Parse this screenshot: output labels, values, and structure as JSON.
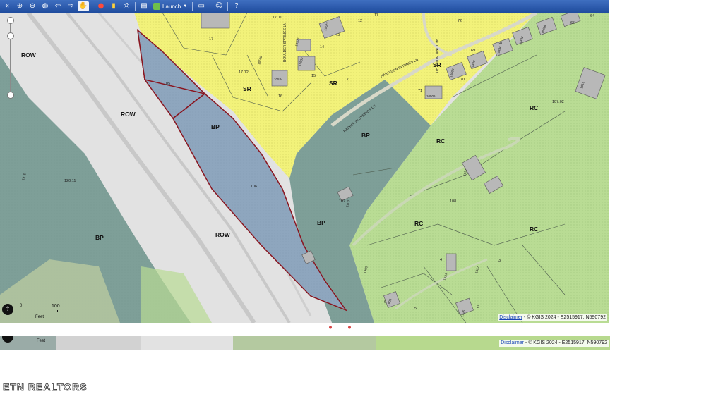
{
  "toolbar": {
    "launch_label": "Launch",
    "buttons": [
      "collapse-icon",
      "zoom-in-icon",
      "zoom-out-icon",
      "full-extent-icon",
      "back-icon",
      "forward-icon",
      "pan-hand-icon",
      "identify-icon",
      "layers-icon",
      "print-icon",
      "ruler-icon",
      "save-icon",
      "person-icon",
      "help-icon"
    ]
  },
  "map": {
    "zone_labels": {
      "row_1": "ROW",
      "row_2": "ROW",
      "row_3": "ROW",
      "sr_1": "SR",
      "sr_2": "SR",
      "sr_3": "SR",
      "bp_1": "BP",
      "bp_2": "BP",
      "bp_3": "BP",
      "bp_4": "BP",
      "rc_1": "RC",
      "rc_2": "RC",
      "rc_3": "RC",
      "rc_4": "RC"
    },
    "parcel_numbers": {
      "p105": "105",
      "p106": "106",
      "p107": "107",
      "p107_02": "107.02",
      "p108": "108",
      "p120_11": "120.11",
      "p17": "17",
      "p17_12": "17.12",
      "p17_11": "17.11",
      "p16": "16",
      "p15": "15",
      "p14": "14",
      "p13": "13",
      "p12": "12",
      "p11": "11",
      "p7": "7",
      "p72": "72",
      "p64": "64",
      "p65": "65",
      "p68": "68",
      "p69": "69",
      "p70": "70",
      "p71": "71",
      "p4": "4",
      "p3": "3",
      "p5": "5",
      "p2": "2",
      "p6": "6"
    },
    "street_labels": {
      "harrison_springs": "HARRISON SPRINGS LN",
      "autumn_bluff": "AUTUMN BLUFF RD",
      "boulder_springs": "BOULDER SPRINGS LN",
      "harrison_lower": "HARRISON SPRINGS LN"
    },
    "address_labels": {
      "a10534": "10534",
      "a10530": "10530",
      "a10526": "10526",
      "a10522": "10522",
      "a10535": "10535",
      "a10600": "10600",
      "a10440": "10440",
      "a10436": "10436",
      "a10432": "10432",
      "a10426": "10426",
      "a10506": "10506",
      "a1919": "1919",
      "a1915": "1915",
      "a1907": "1907",
      "a1824": "1824",
      "a1822": "1822",
      "a1825": "1825",
      "a1925": "1925",
      "a1932": "1932",
      "a1900": "1900"
    },
    "scale": {
      "zero": "0",
      "max": "100",
      "unit": "Feet"
    },
    "credits": {
      "disclaimer": "Disclaimer",
      "text": "- © KGIS 2024 - E2515917, N590792"
    }
  },
  "ghost": {
    "feet": "Feet",
    "credits": {
      "disclaimer": "Disclaimer",
      "text": "- © KGIS 2024 - E2515917, N590792"
    }
  },
  "watermark": "ETN REALTORS",
  "colors": {
    "bp": "#8da5bf",
    "row": "#e4e4e4",
    "sr": "#f1f279",
    "rc": "#b9dc94",
    "parcel_outline": "#8a1620",
    "toolbar": "#2856a8"
  }
}
